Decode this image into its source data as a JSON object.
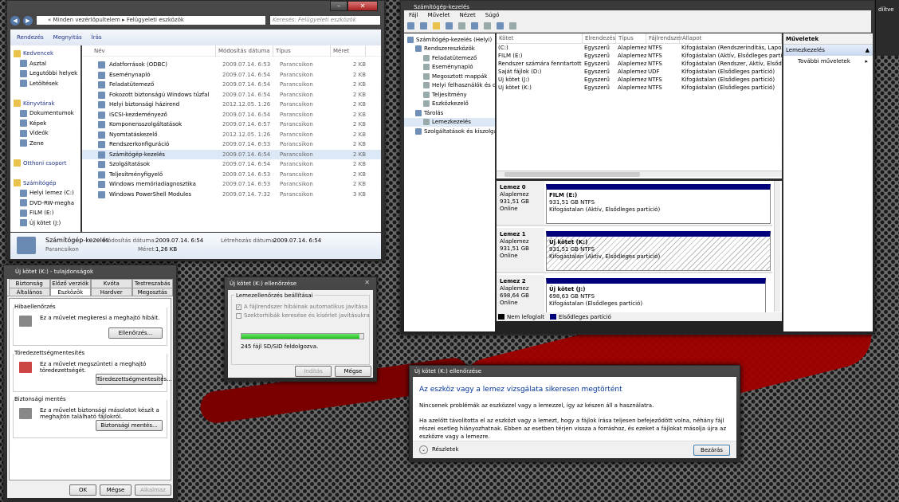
{
  "explorer": {
    "path": [
      "Minden vezérlőpultelem",
      "Felügyeleti eszközök"
    ],
    "search_placeholder": "Keresés: Felügyeleti eszközök",
    "toolbar": {
      "organize": "Rendezés",
      "share": "Megnyitás",
      "burn": "Írás"
    },
    "nav": [
      {
        "label": "Kedvencek",
        "icon": "star-icon",
        "h": 1
      },
      {
        "label": "Asztal",
        "icon": "desktop-icon"
      },
      {
        "label": "Legutóbbi helyek",
        "icon": "recent-icon"
      },
      {
        "label": "Letöltések",
        "icon": "downloads-icon"
      },
      {
        "label": "",
        "icon": ""
      },
      {
        "label": "Könyvtárak",
        "icon": "libraries-icon",
        "h": 1
      },
      {
        "label": "Dokumentumok",
        "icon": "documents-icon"
      },
      {
        "label": "Képek",
        "icon": "pictures-icon"
      },
      {
        "label": "Videók",
        "icon": "videos-icon"
      },
      {
        "label": "Zene",
        "icon": "music-icon"
      },
      {
        "label": "",
        "icon": ""
      },
      {
        "label": "Otthoni csoport",
        "icon": "homegroup-icon",
        "h": 1
      },
      {
        "label": "",
        "icon": ""
      },
      {
        "label": "Számítógép",
        "icon": "computer-icon",
        "h": 1
      },
      {
        "label": "Helyi lemez (C:)",
        "icon": "drive-icon"
      },
      {
        "label": "DVD-RW-megha",
        "icon": "dvd-icon"
      },
      {
        "label": "FILM (E:)",
        "icon": "drive-icon"
      },
      {
        "label": "Új kötet (J:)",
        "icon": "drive-icon"
      }
    ],
    "columns": [
      "Név",
      "Módosítás dátuma",
      "Típus",
      "Méret"
    ],
    "files": [
      [
        "Adatforrások (ODBC)",
        "2009.07.14. 6:53",
        "Parancsikon",
        "2 KB"
      ],
      [
        "Eseménynapló",
        "2009.07.14. 6:54",
        "Parancsikon",
        "2 KB"
      ],
      [
        "Feladatütemező",
        "2009.07.14. 6:54",
        "Parancsikon",
        "2 KB"
      ],
      [
        "Fokozott biztonságú Windows tűzfal",
        "2009.07.14. 6:54",
        "Parancsikon",
        "2 KB"
      ],
      [
        "Helyi biztonsági házirend",
        "2012.12.05. 1:26",
        "Parancsikon",
        "2 KB"
      ],
      [
        "iSCSI-kezdeményező",
        "2009.07.14. 6:54",
        "Parancsikon",
        "2 KB"
      ],
      [
        "Komponensszolgáltatások",
        "2009.07.14. 6:57",
        "Parancsikon",
        "2 KB"
      ],
      [
        "Nyomtatáskezelő",
        "2012.12.05. 1:26",
        "Parancsikon",
        "2 KB"
      ],
      [
        "Rendszerkonfiguráció",
        "2009.07.14. 6:53",
        "Parancsikon",
        "2 KB"
      ],
      [
        "Számítógép-kezelés",
        "2009.07.14. 6:54",
        "Parancsikon",
        "2 KB"
      ],
      [
        "Szolgáltatások",
        "2009.07.14. 6:54",
        "Parancsikon",
        "2 KB"
      ],
      [
        "Teljesítményfigyelő",
        "2009.07.14. 6:53",
        "Parancsikon",
        "2 KB"
      ],
      [
        "Windows memóriadiagnosztika",
        "2009.07.14. 6:53",
        "Parancsikon",
        "2 KB"
      ],
      [
        "Windows PowerShell Modules",
        "2009.07.14. 7:32",
        "Parancsikon",
        "3 KB"
      ]
    ],
    "details": {
      "name": "Számítógép-kezelés",
      "type": "Parancsikon",
      "modified_label": "Módosítás dátuma:",
      "modified": "2009.07.14. 6:54",
      "created_label": "Létrehozás dátuma:",
      "created": "2009.07.14. 6:54",
      "size_label": "Méret:",
      "size": "1,26 KB"
    }
  },
  "mmc": {
    "title": "Számítógép-kezelés",
    "menu": [
      "Fájl",
      "Művelet",
      "Nézet",
      "Súgó"
    ],
    "tree": [
      {
        "label": "Számítógép-kezelés (Helyi)",
        "lvl": 0
      },
      {
        "label": "Rendszereszközök",
        "lvl": 1
      },
      {
        "label": "Feladatütemező",
        "lvl": 2
      },
      {
        "label": "Eseménynapló",
        "lvl": 2
      },
      {
        "label": "Megosztott mappák",
        "lvl": 2
      },
      {
        "label": "Helyi felhasználók és cs",
        "lvl": 2
      },
      {
        "label": "Teljesítmény",
        "lvl": 2
      },
      {
        "label": "Eszközkezelő",
        "lvl": 2
      },
      {
        "label": "Tárolás",
        "lvl": 1
      },
      {
        "label": "Lemezkezelés",
        "lvl": 2
      },
      {
        "label": "Szolgáltatások és kiszolgál",
        "lvl": 1
      }
    ],
    "columns": [
      "Kötet",
      "Elrendezés",
      "Típus",
      "Fájlrendszer",
      "Állapot"
    ],
    "volumes": [
      [
        "(C:)",
        "Egyszerű",
        "Alaplemez",
        "NTFS",
        "Kifogástalan (Rendszerindítás, Lapozófájl"
      ],
      [
        "FILM (E:)",
        "Egyszerű",
        "Alaplemez",
        "NTFS",
        "Kifogástalan (Aktív, Elsődleges partíció)"
      ],
      [
        "Rendszer számára fenntartott",
        "Egyszerű",
        "Alaplemez",
        "NTFS",
        "Kifogástalan (Rendszer, Aktív, Elsődleges"
      ],
      [
        "Saját fájlok (D:)",
        "Egyszerű",
        "Alaplemez",
        "UDF",
        "Kifogástalan (Elsődleges partíció)"
      ],
      [
        "Új kötet (J:)",
        "Egyszerű",
        "Alaplemez",
        "NTFS",
        "Kifogástalan (Elsődleges partíció)"
      ],
      [
        "Új kötet (K:)",
        "Egyszerű",
        "Alaplemez",
        "NTFS",
        "Kifogástalan (Elsődleges partíció)"
      ]
    ],
    "disks": [
      {
        "name": "Lemez 0",
        "type": "Alaplemez",
        "size": "931,51 GB",
        "status": "Online",
        "vol": "FILM  (E:)",
        "vsize": "931,51 GB NTFS",
        "vstat": "Kifogástalan (Aktív, Elsődleges partíció)"
      },
      {
        "name": "Lemez 1",
        "type": "Alaplemez",
        "size": "931,51 GB",
        "status": "Online",
        "vol": "Új kötet  (K:)",
        "vsize": "931,51 GB NTFS",
        "vstat": "Kifogástalan (Aktív, Elsődleges partíció)"
      },
      {
        "name": "Lemez 2",
        "type": "Alaplemez",
        "size": "698,64 GB",
        "status": "Online",
        "vol": "Új kötet  (J:)",
        "vsize": "698,63 GB NTFS",
        "vstat": "Kifogástalan (Elsődleges partíció)"
      }
    ],
    "legend": [
      "Nem lefoglalt",
      "Elsődleges partíció"
    ],
    "actions": {
      "title": "Műveletek",
      "section": "Lemezkezelés",
      "more": "További műveletek"
    },
    "extra": "díítve"
  },
  "props": {
    "title": "Új kötet (K:) - tulajdonságok",
    "tabs_top": [
      "Biztonság",
      "Előző verziók",
      "Kvóta",
      "Testreszabás"
    ],
    "tabs_bottom": [
      "Általános",
      "Eszközök",
      "Hardver",
      "Megosztás"
    ],
    "sections": [
      {
        "title": "Hibaellenőrzés",
        "text": "Ez a művelet megkeresi a meghajtó hibáit.",
        "button": "Ellenőrzés..."
      },
      {
        "title": "Töredezettségmentesítés",
        "text": "Ez a művelet megszünteti a meghajtó töredezettségét.",
        "button": "Töredezettségmentesítés..."
      },
      {
        "title": "Biztonsági mentés",
        "text": "Ez a művelet biztonsági másolatot készít a meghajtón található fájlokról.",
        "button": "Biztonsági mentés..."
      }
    ],
    "ok": "OK",
    "cancel": "Mégse",
    "apply": "Alkalmaz"
  },
  "check": {
    "title": "Új kötet (K:) ellenőrzése",
    "group": "Lemezellenőrzés beállításai",
    "opt1": "A fájlrendszer hibáinak automatikus javítása",
    "opt2": "Szektorhibák keresése és kísérlet javításukra",
    "progress": 0.97,
    "status": "245 fájl SD/SID feldolgozva.",
    "start": "Indítás",
    "cancel": "Mégse"
  },
  "done": {
    "title": "Új kötet (K:) ellenőrzése",
    "heading": "Az eszköz vagy a lemez vizsgálata sikeresen megtörtént",
    "line1": "Nincsenek problémák az eszközzel vagy a lemezzel, így az készen áll a használatra.",
    "line2": "Ha azelőtt távolította el az eszközt vagy a lemezt, hogy a fájlok írása teljesen befejeződött volna, néhány fájl részei esetleg hiányozhatnak. Ebben az esetben térjen vissza a forráshoz, és ezeket a fájlokat másolja újra az eszközre vagy a lemezre.",
    "details": "Részletek",
    "close": "Bezárás"
  },
  "colors": {
    "accent": "#003399",
    "volbar": "#00007a",
    "progress": "#1fbf1f"
  }
}
